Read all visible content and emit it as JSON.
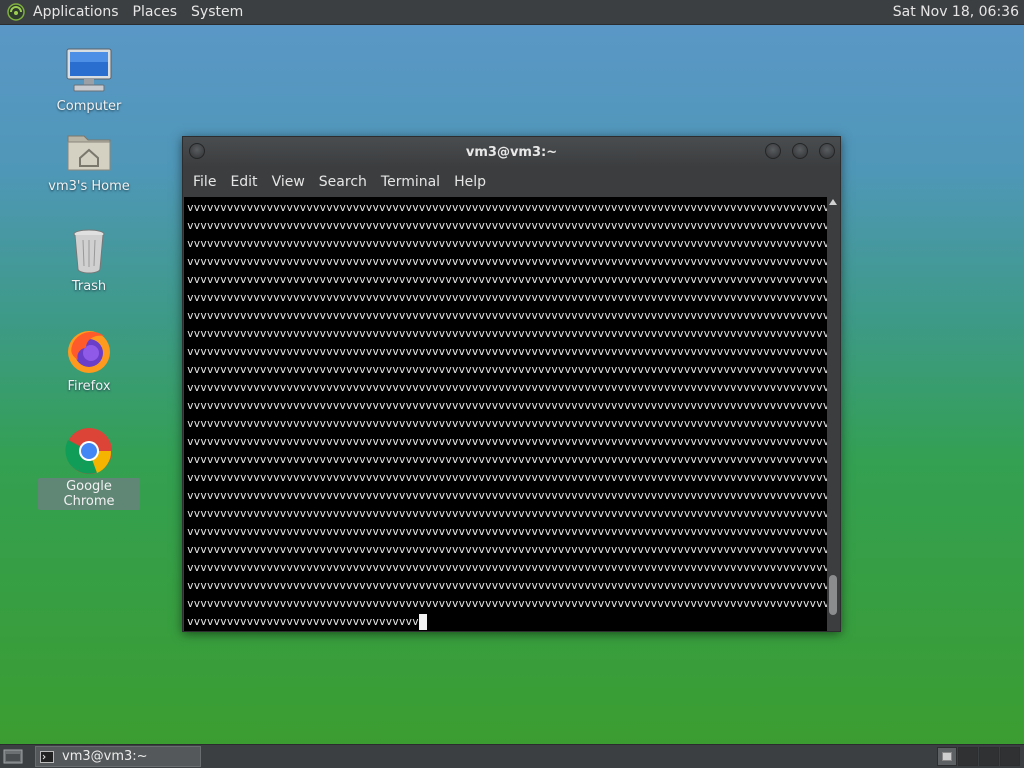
{
  "top_panel": {
    "menus": [
      "Applications",
      "Places",
      "System"
    ],
    "clock": "Sat Nov 18, 06:36"
  },
  "desktop": {
    "icons": [
      {
        "label": "Computer",
        "icon": "computer-icon"
      },
      {
        "label": "vm3's Home",
        "icon": "home-folder-icon"
      },
      {
        "label": "Trash",
        "icon": "trash-icon"
      },
      {
        "label": "Firefox",
        "icon": "firefox-icon"
      },
      {
        "label": "Google Chrome",
        "icon": "chrome-icon"
      }
    ]
  },
  "terminal": {
    "title": "vm3@vm3:~",
    "menus": [
      "File",
      "Edit",
      "View",
      "Search",
      "Terminal",
      "Help"
    ],
    "line_text": "vvvvvvvvvvvvvvvvvvvvvvvvvvvvvvvvvvvvvvvvvvvvvvvvvvvvvvvvvvvvvvvvvvvvvvvvvvvvvvvvvvvvvvvvvvvvvvvvvvvvvvvvv",
    "full_lines": 23,
    "last_line_text": "vvvvvvvvvvvvvvvvvvvvvvvvvvvvvvvvvvv"
  },
  "bottom_panel": {
    "task_label": "vm3@vm3:~"
  },
  "colors": {
    "panel": "#3c3f41",
    "terminal_bg": "#000000",
    "terminal_fg": "#e8e8e8"
  }
}
